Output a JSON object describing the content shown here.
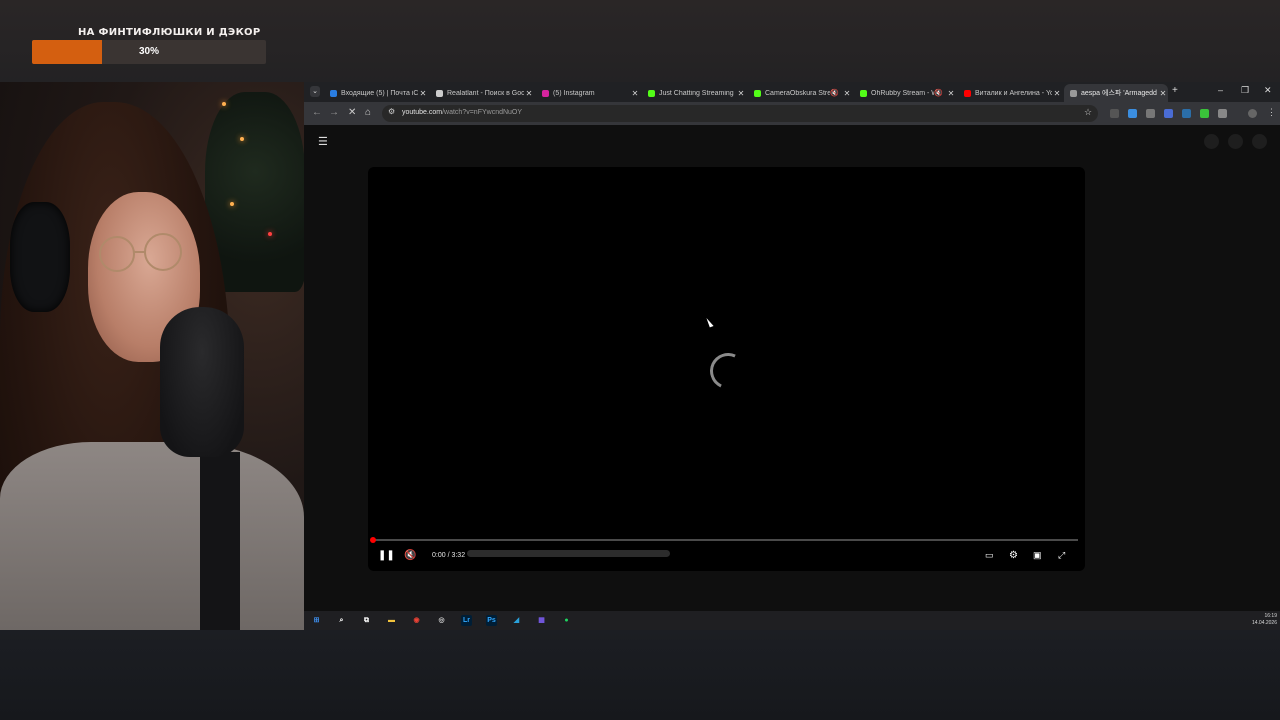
{
  "stream": {
    "goal_title": "НА ФИНТИФЛЮШКИ И ДЭКОР",
    "goal_percent_label": "30%",
    "goal_progress": 0.3,
    "accent_color": "#d45f10"
  },
  "browser": {
    "tabs": [
      {
        "title": "Входящие (5) | Почта iCl",
        "favicon_color": "#2a7de1",
        "muted": false,
        "active": false
      },
      {
        "title": "Realatlant - Поиск в Goo",
        "favicon_color": "#cccccc",
        "muted": false,
        "active": false
      },
      {
        "title": "(5) Instagram",
        "favicon_color": "#d6249f",
        "muted": false,
        "active": false
      },
      {
        "title": "Just Chatting Streaming -",
        "favicon_color": "#53fc18",
        "muted": false,
        "active": false
      },
      {
        "title": "CameraObskura Strea",
        "favicon_color": "#53fc18",
        "muted": true,
        "active": false
      },
      {
        "title": "OhRubby Stream - W",
        "favicon_color": "#53fc18",
        "muted": true,
        "active": false
      },
      {
        "title": "Виталик и Ангелина - Yo",
        "favicon_color": "#ff0000",
        "muted": false,
        "active": false
      },
      {
        "title": "aespa 에스파 'Armagedd",
        "favicon_color": "#999999",
        "muted": false,
        "active": true
      }
    ],
    "url_domain": "youtube.com",
    "url_path": "/watch?v=nFYwcndNuOY",
    "tabs_dropdown_icon": "chevron-down",
    "new_tab_label": "+",
    "window_controls": [
      "–",
      "❐",
      "✕"
    ]
  },
  "player": {
    "current_time": "0:00",
    "duration": "3:32",
    "time_label": "0:00 / 3:32",
    "progress": 0.0,
    "state": "loading"
  },
  "taskbar": {
    "time": "16:19",
    "date": "14.04.2026",
    "apps": [
      {
        "name": "windows-start",
        "label": "",
        "color": "#3d8be8"
      },
      {
        "name": "search",
        "label": "",
        "color": "#ffffff"
      },
      {
        "name": "task-view",
        "label": "",
        "color": "#ffffff"
      },
      {
        "name": "file-explorer",
        "label": "",
        "color": "#f3c33c"
      },
      {
        "name": "chrome",
        "label": "",
        "color": "#e94235"
      },
      {
        "name": "obs",
        "label": "",
        "color": "#cccccc"
      },
      {
        "name": "lightroom",
        "label": "Lr",
        "color": "#31a8ff"
      },
      {
        "name": "photoshop",
        "label": "Ps",
        "color": "#31a8ff"
      },
      {
        "name": "telegram",
        "label": "",
        "color": "#2aa1da"
      },
      {
        "name": "app-grid",
        "label": "",
        "color": "#7b5cf0"
      },
      {
        "name": "spotify",
        "label": "",
        "color": "#1ed760"
      }
    ]
  }
}
